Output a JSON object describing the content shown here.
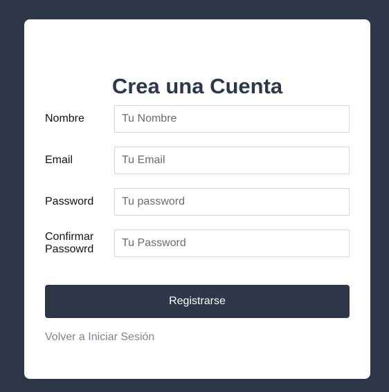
{
  "form": {
    "title": "Crea una Cuenta",
    "fields": [
      {
        "label": "Nombre",
        "placeholder": "Tu Nombre",
        "value": ""
      },
      {
        "label": "Email",
        "placeholder": "Tu Email",
        "value": ""
      },
      {
        "label": "Password",
        "placeholder": "Tu password",
        "value": ""
      },
      {
        "label": "Confirmar Passowrd",
        "placeholder": "Tu Password",
        "value": ""
      }
    ],
    "submit_label": "Registrarse",
    "back_link": "Volver a Iniciar Sesión"
  },
  "colors": {
    "background": "#2d3748",
    "card": "#ffffff",
    "button": "#2d3748",
    "link": "#7d8490"
  }
}
